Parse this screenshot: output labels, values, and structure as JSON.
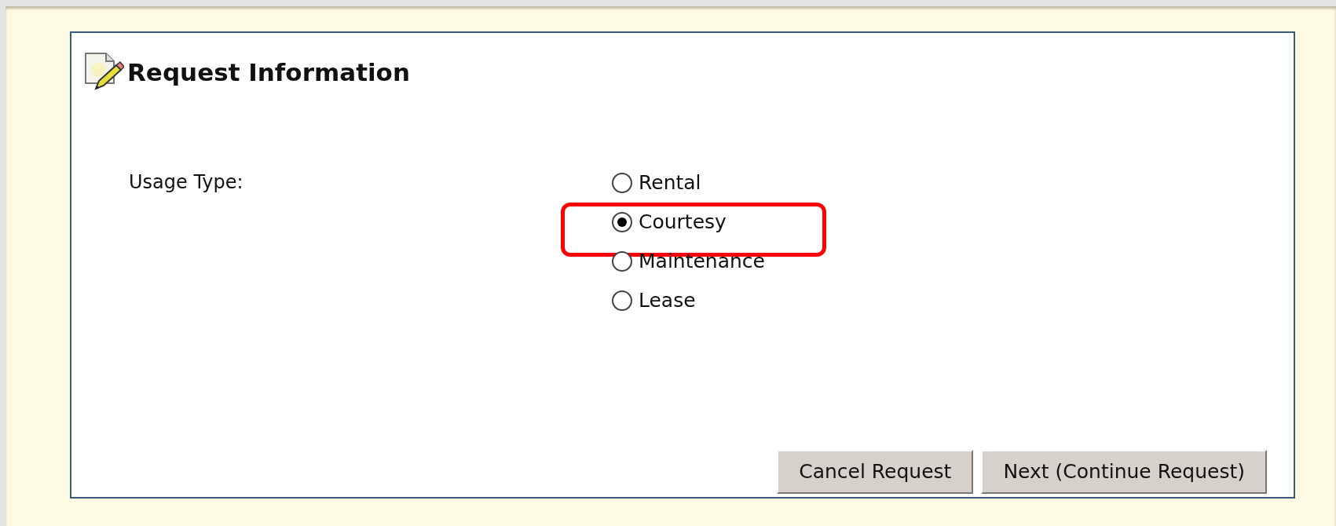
{
  "panel": {
    "title": "Request Information"
  },
  "usage_type": {
    "label": "Usage Type:",
    "options": [
      {
        "label": "Rental",
        "selected": false,
        "highlighted": false
      },
      {
        "label": "Courtesy",
        "selected": true,
        "highlighted": true
      },
      {
        "label": "Maintenance",
        "selected": false,
        "highlighted": false
      },
      {
        "label": "Lease",
        "selected": false,
        "highlighted": false
      }
    ]
  },
  "buttons": [
    {
      "label": "Cancel Request"
    },
    {
      "label": "Next (Continue Request)"
    }
  ]
}
